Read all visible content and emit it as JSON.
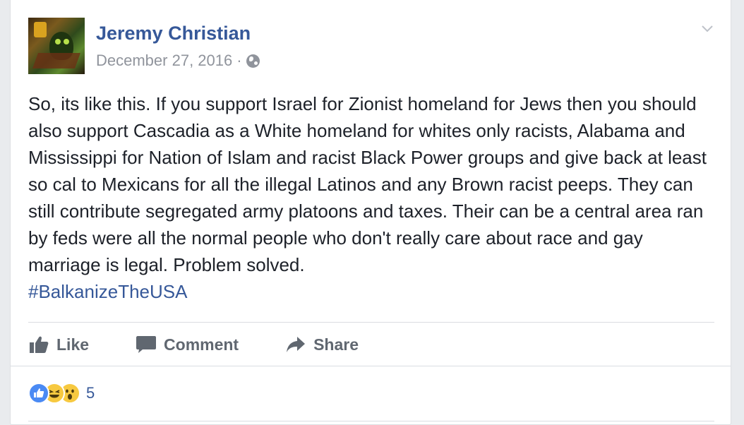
{
  "post": {
    "author": "Jeremy Christian",
    "date": "December 27, 2016",
    "separator": "·",
    "privacy_icon": "globe-icon",
    "menu_icon": "chevron-down-icon",
    "body": "So, its like this. If you support Israel for Zionist homeland for Jews then you should also support Cascadia as a White homeland for whites only racists, Alabama and Mississippi for Nation of Islam and racist Black Power groups and give back at least so cal to Mexicans for all the illegal Latinos and any Brown racist peeps. They can still contribute segregated army platoons and taxes. Their can be a central area ran by feds were all the normal people who don't really care about race and gay marriage is legal. Problem solved.",
    "hashtag": "#BalkanizeTheUSA"
  },
  "actions": {
    "like_label": "Like",
    "comment_label": "Comment",
    "share_label": "Share"
  },
  "reactions": {
    "types": [
      "like-reaction-icon",
      "haha-reaction-icon",
      "wow-reaction-icon"
    ],
    "count": "5"
  },
  "colors": {
    "link": "#365899",
    "text": "#1d2129",
    "muted": "#90949c",
    "action": "#606770",
    "like_blue": "#4a8af4",
    "emoji_yellow": "#f7c940"
  }
}
